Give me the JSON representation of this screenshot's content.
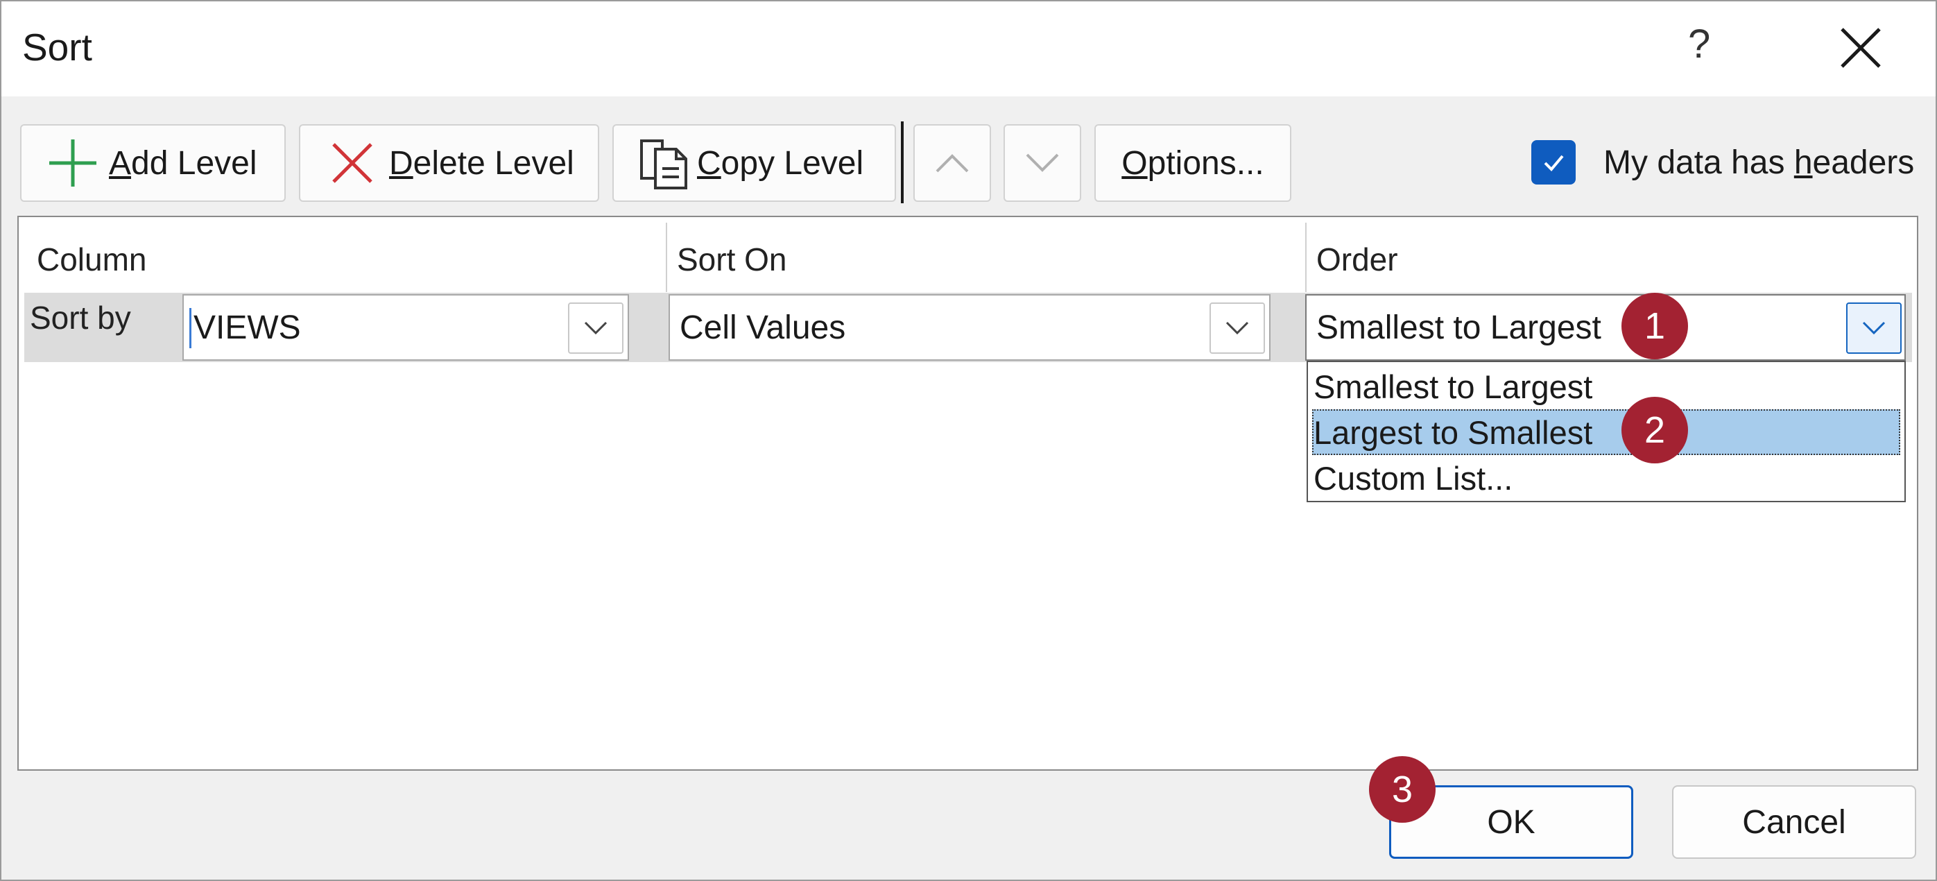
{
  "dialog": {
    "title": "Sort",
    "help_label": "?"
  },
  "toolbar": {
    "add_level": {
      "prefix": "",
      "accel": "A",
      "rest": "dd Level"
    },
    "delete_level": {
      "prefix": "",
      "accel": "D",
      "rest": "elete Level"
    },
    "copy_level": {
      "prefix": "",
      "accel": "C",
      "rest": "opy Level"
    },
    "options": {
      "prefix": "",
      "accel": "O",
      "rest": "ptions..."
    },
    "headers_checkbox": {
      "checked": true,
      "prefix": "My data has ",
      "accel": "h",
      "rest": "eaders"
    }
  },
  "grid": {
    "headers": {
      "column": "Column",
      "sort_on": "Sort On",
      "order": "Order"
    },
    "row": {
      "label": "Sort by",
      "column_value": "VIEWS",
      "sort_on_value": "Cell Values",
      "order_value": "Smallest to Largest"
    },
    "order_options": [
      "Smallest to Largest",
      "Largest to Smallest",
      "Custom List..."
    ],
    "order_options_highlighted": "Largest to Smallest"
  },
  "callouts": [
    "1",
    "2",
    "3"
  ],
  "footer": {
    "ok": "OK",
    "cancel": "Cancel"
  },
  "colors": {
    "accent": "#0f5cbf",
    "highlight": "#a7ccec",
    "callout": "#a32232",
    "add_icon": "#2e9e4f",
    "delete_icon": "#d13438"
  },
  "icons": [
    "close-icon",
    "plus-icon",
    "delete-x-icon",
    "copy-icon",
    "chevron-up-icon",
    "chevron-down-icon",
    "checkmark-icon"
  ]
}
